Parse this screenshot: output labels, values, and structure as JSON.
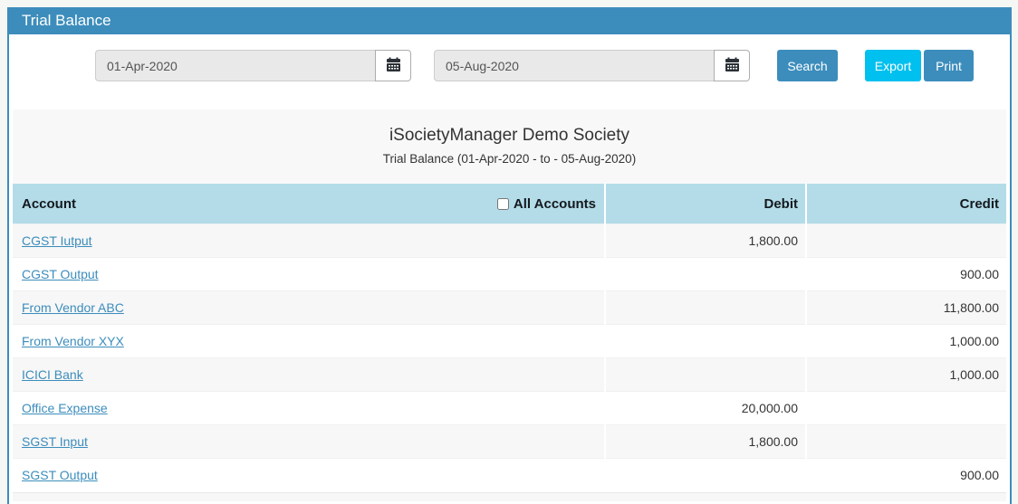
{
  "panel": {
    "title": "Trial Balance"
  },
  "filters": {
    "from_date": "01-Apr-2020",
    "to_date": "05-Aug-2020",
    "search_label": "Search",
    "export_label": "Export",
    "print_label": "Print"
  },
  "report": {
    "society_title": "iSocietyManager Demo Society",
    "subtitle": "Trial Balance (01-Apr-2020 - to - 05-Aug-2020)"
  },
  "table": {
    "headers": {
      "account": "Account",
      "all_accounts": "All Accounts",
      "debit": "Debit",
      "credit": "Credit"
    },
    "all_accounts_checked": false,
    "rows": [
      {
        "account": "CGST Iutput",
        "debit": "1,800.00",
        "credit": ""
      },
      {
        "account": "CGST Output",
        "debit": "",
        "credit": "900.00"
      },
      {
        "account": "From Vendor ABC",
        "debit": "",
        "credit": "11,800.00"
      },
      {
        "account": "From Vendor XYX",
        "debit": "",
        "credit": "1,000.00"
      },
      {
        "account": "ICICI Bank",
        "debit": "",
        "credit": "1,000.00"
      },
      {
        "account": "Office Expense",
        "debit": "20,000.00",
        "credit": ""
      },
      {
        "account": "SGST Input",
        "debit": "1,800.00",
        "credit": ""
      },
      {
        "account": "SGST Output",
        "debit": "",
        "credit": "900.00"
      }
    ]
  },
  "icons": {
    "calendar": "calendar-icon"
  },
  "colors": {
    "primary_blue": "#3c8dbc",
    "info_cyan": "#00c0ef",
    "table_header_blue": "#b3dce8",
    "row_stripe_gray": "#f7f7f7",
    "link_blue": "#3c8dbc"
  }
}
